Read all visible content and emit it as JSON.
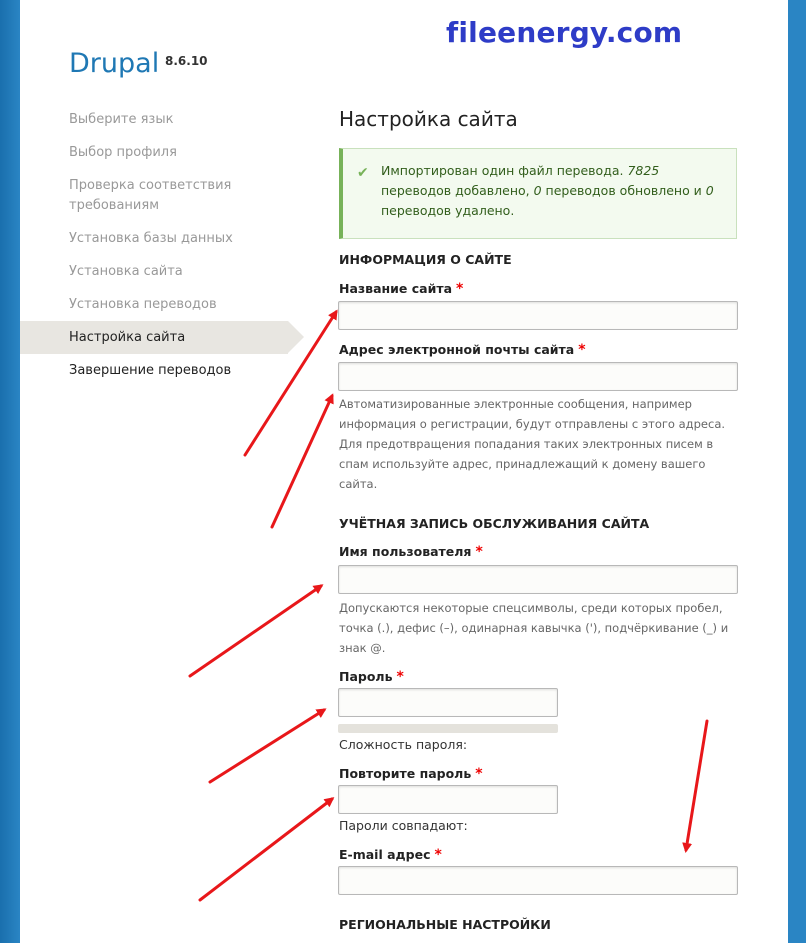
{
  "watermark": "fileenergy.com",
  "logo": {
    "name": "Drupal",
    "version": "8.6.10"
  },
  "steps": [
    {
      "label": "Выберите язык",
      "state": "done"
    },
    {
      "label": "Выбор профиля",
      "state": "done"
    },
    {
      "label": "Проверка соответствия требованиям",
      "state": "done"
    },
    {
      "label": "Установка базы данных",
      "state": "done"
    },
    {
      "label": "Установка сайта",
      "state": "done"
    },
    {
      "label": "Установка переводов",
      "state": "done"
    },
    {
      "label": "Настройка сайта",
      "state": "active"
    },
    {
      "label": "Завершение переводов",
      "state": "pending"
    }
  ],
  "page_title": "Настройка сайта",
  "message": {
    "part1": "Импортирован один файл перевода. ",
    "count_added": "7825",
    "part2": " переводов добавлено, ",
    "count_updated": "0",
    "part3": " переводов обновлено и ",
    "count_deleted": "0",
    "part4": " переводов удалено."
  },
  "sections": {
    "site_info": "ИНФОРМАЦИЯ О САЙТЕ",
    "maintenance": "УЧЁТНАЯ ЗАПИСЬ ОБСЛУЖИВАНИЯ САЙТА",
    "regional": "РЕГИОНАЛЬНЫЕ НАСТРОЙКИ"
  },
  "fields": {
    "site_name": {
      "label": "Название сайта",
      "value": ""
    },
    "site_email": {
      "label": "Адрес электронной почты сайта",
      "value": "",
      "description": "Автоматизированные электронные сообщения, например информация о регистрации, будут отправлены с этого адреса. Для предотвращения попадания таких электронных писем в спам используйте адрес, принадлежащий к домену вашего сайта."
    },
    "username": {
      "label": "Имя пользователя",
      "value": "",
      "description": "Допускаются некоторые спецсимволы, среди которых пробел, точка (.), дефис (–), одинарная кавычка ('), подчёркивание (_) и знак @."
    },
    "password": {
      "label": "Пароль",
      "value": "",
      "strength_label": "Сложность пароля:",
      "strength": 0
    },
    "password_confirm": {
      "label": "Повторите пароль",
      "value": "",
      "match_label": "Пароли совпадают:"
    },
    "email": {
      "label": "E-mail адрес",
      "value": ""
    }
  },
  "required_marker": "*",
  "colors": {
    "accent": "#1f78b4",
    "required": "#e00000",
    "arrow": "#e8171a",
    "status_green": "#77b259"
  }
}
